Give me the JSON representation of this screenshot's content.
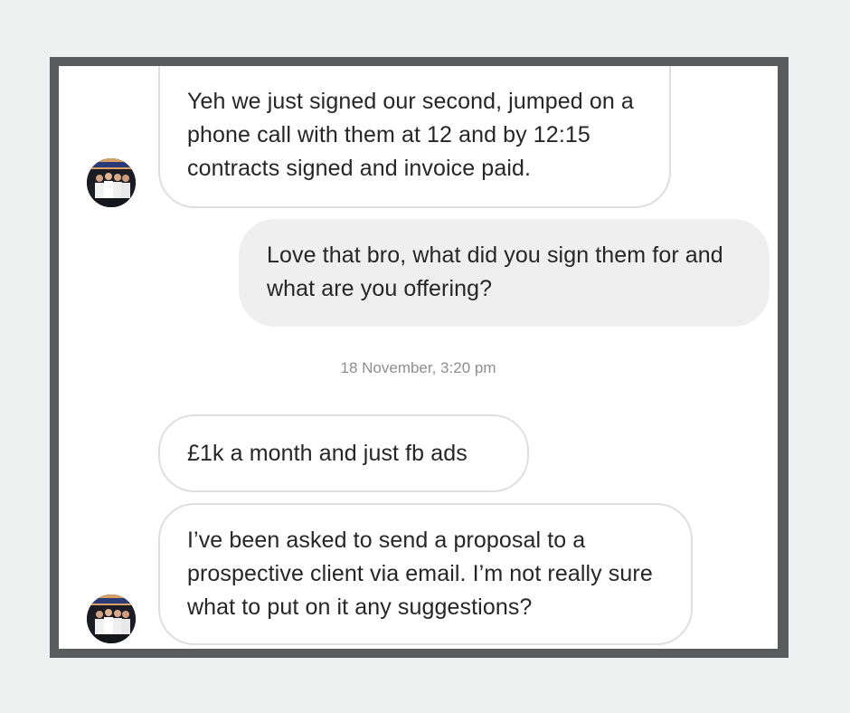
{
  "conversation": {
    "messages": [
      {
        "direction": "incoming",
        "text": "Yeh we just signed our second, jumped on a phone call with them at 12 and by 12:15 contracts signed and invoice paid."
      },
      {
        "direction": "outgoing",
        "text": "Love that bro, what did you sign them for and what are you offering?"
      },
      {
        "direction": "incoming",
        "text": "£1k a month and just fb ads"
      },
      {
        "direction": "incoming",
        "text": "I’ve been asked to send a proposal to a prospective client via email. I’m not really sure what to put on it any suggestions?"
      }
    ],
    "timestamp": "18 November, 3:20 pm"
  },
  "colors": {
    "page_background": "#eff0f0",
    "frame": "#5a5b5d",
    "chat_background": "#ffffff",
    "outgoing_bubble": "#efefef",
    "incoming_border": "#dedede",
    "text": "#262626",
    "timestamp_text": "#8e8e8e"
  },
  "icons": {
    "avatar": "group-photo-avatar-icon"
  }
}
